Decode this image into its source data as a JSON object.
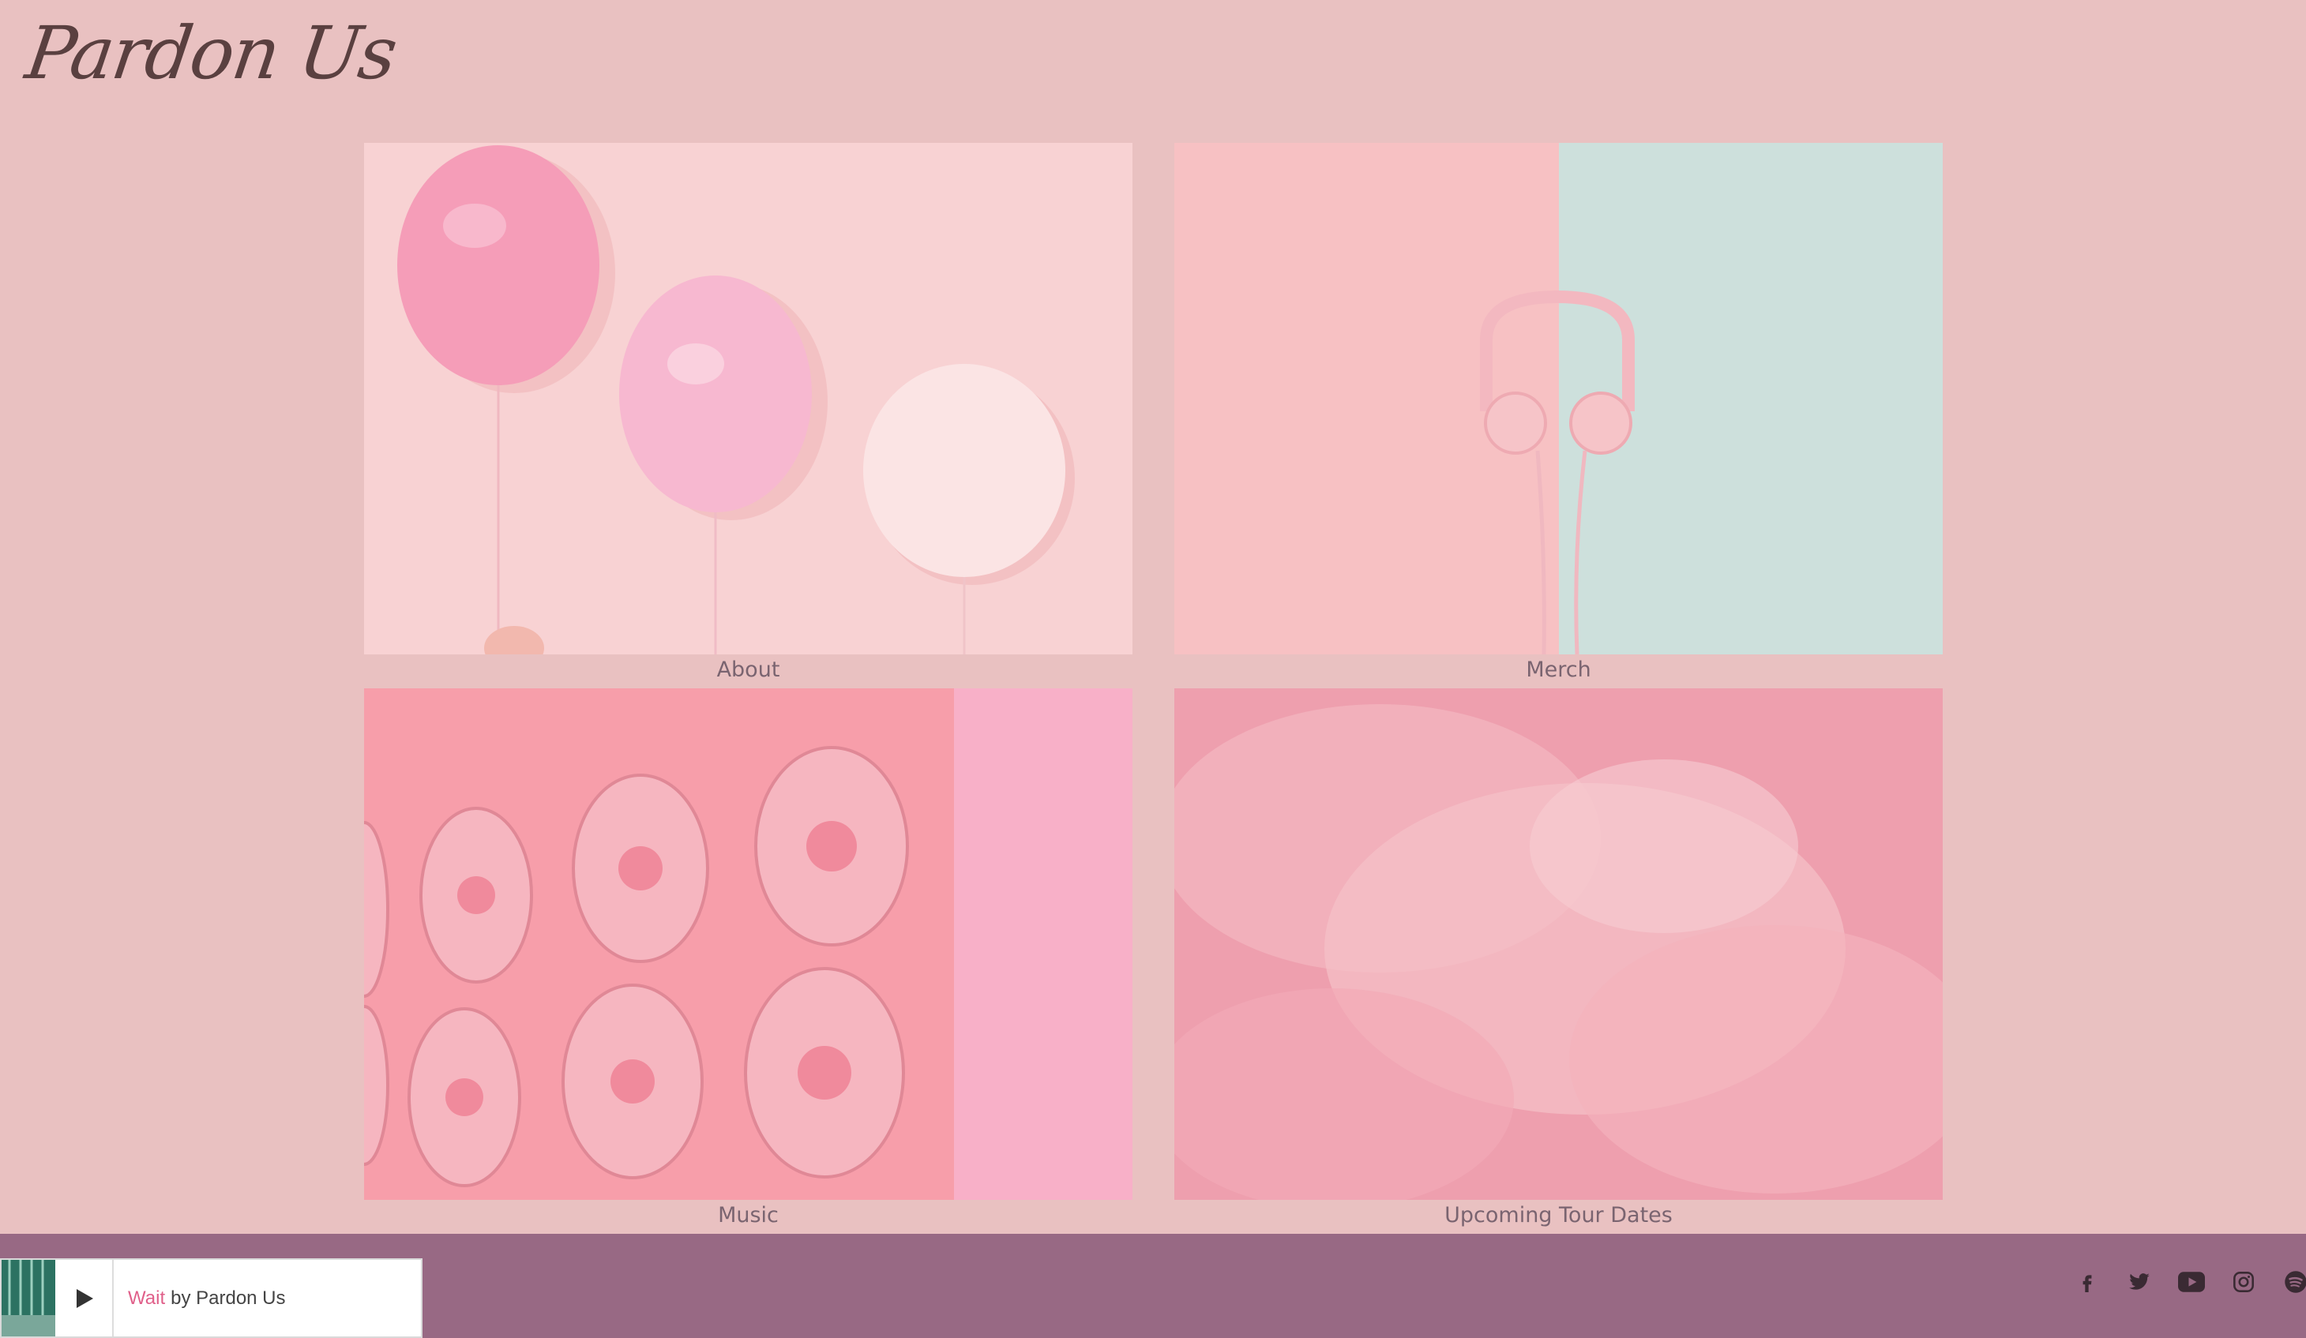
{
  "brand": {
    "name": "Pardon Us"
  },
  "tiles": [
    {
      "id": "about",
      "label": "About"
    },
    {
      "id": "merch",
      "label": "Merch"
    },
    {
      "id": "music",
      "label": "Music"
    },
    {
      "id": "tour",
      "label": "Upcoming Tour Dates"
    }
  ],
  "player": {
    "track_title": "Wait",
    "by_text": "by Pardon Us",
    "play_icon": "play-icon"
  },
  "social": [
    {
      "name": "facebook-icon"
    },
    {
      "name": "twitter-icon"
    },
    {
      "name": "youtube-icon"
    },
    {
      "name": "instagram-icon"
    },
    {
      "name": "spotify-icon"
    }
  ],
  "colors": {
    "background": "#e9c1c1",
    "footer": "#986984",
    "accent": "#e0608a",
    "text": "#5a4040"
  }
}
